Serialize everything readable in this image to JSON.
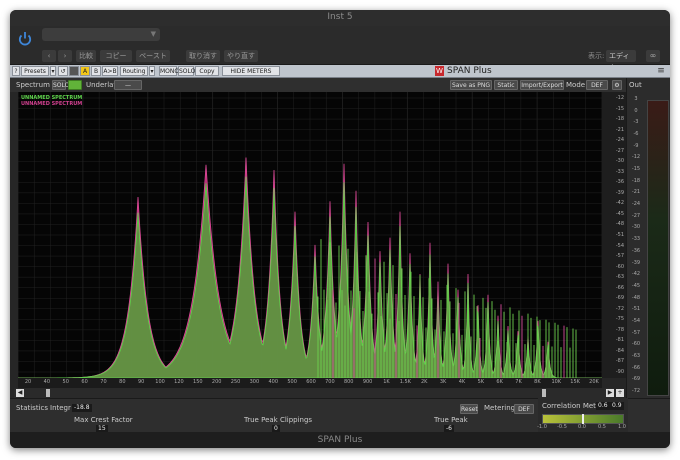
{
  "window": {
    "title": "Inst 5"
  },
  "host": {
    "preset_value": "",
    "buttons": {
      "compare": "比較",
      "copy": "コピー",
      "paste": "ペースト",
      "undo": "取り消す",
      "redo": "やり直す"
    },
    "view_label": "表示:",
    "view_value": "エディタ"
  },
  "plugin_bar": {
    "presets": "Presets",
    "a_label": "A",
    "b_label": "B",
    "ab_label": "A>B",
    "routing": "Routing",
    "mono": "MONO",
    "solo": "SOLO",
    "copy_to": "Copy to",
    "hide_meters": "HIDE METERS AND STATS",
    "brand": "SPAN Plus",
    "logo_letter": "W"
  },
  "spectrum_header": {
    "label": "Spectrum",
    "btn1": "SOLO",
    "btn2": "",
    "underlay_label": "Underlay",
    "underlay_value": "—",
    "save_png": "Save as PNG",
    "static": "Static",
    "import_export": "Import/Export",
    "mode_label": "Mode",
    "mode_value": "DEF"
  },
  "legend": [
    {
      "label": "UNNAMED SPECTRUM",
      "color": "#5fd44c"
    },
    {
      "label": "UNNAMED SPECTRUM",
      "color": "#d0408f"
    }
  ],
  "db_scale": [
    "-12",
    "-15",
    "-18",
    "-21",
    "-24",
    "-27",
    "-30",
    "-33",
    "-36",
    "-39",
    "-42",
    "-45",
    "-48",
    "-51",
    "-54",
    "-57",
    "-60",
    "-63",
    "-66",
    "-69",
    "-72",
    "-75",
    "-78",
    "-81",
    "-84",
    "-87",
    "-90"
  ],
  "freq_labels": [
    "20",
    "40",
    "50",
    "60",
    "70",
    "80",
    "90",
    "100",
    "120",
    "150",
    "200",
    "250",
    "300",
    "400",
    "500",
    "600",
    "700",
    "800",
    "900",
    "1K",
    "1.5K",
    "2K",
    "3K",
    "4K",
    "5K",
    "6K",
    "7K",
    "8K",
    "10K",
    "15K",
    "20K"
  ],
  "out_panel": {
    "label": "Out",
    "scale": [
      "3",
      "0",
      "-3",
      "-6",
      "-9",
      "-12",
      "-15",
      "-18",
      "-21",
      "-24",
      "-27",
      "-30",
      "-33",
      "-36",
      "-39",
      "-42",
      "-45",
      "-48",
      "-51",
      "-54",
      "-57",
      "-60",
      "-63",
      "-66",
      "-69",
      "-72"
    ]
  },
  "stats": {
    "label": "Statistics",
    "integr_label": "Integr",
    "integr_value": "-18.8",
    "reset": "Reset",
    "metering_label": "Metering",
    "metering_value": "DEF",
    "max_crest_label": "Max Crest Factor",
    "max_crest_value": "15",
    "tp_clip_label": "True Peak Clippings",
    "tp_clip_value": "0",
    "true_peak_label": "True Peak",
    "true_peak_value": "-6"
  },
  "correlation": {
    "label": "Correlation Meter",
    "v1": "0.6",
    "v2": "0.9",
    "scale": [
      "-1.0",
      "-0.5",
      "0.0",
      "0.5",
      "1.0"
    ]
  },
  "footer": {
    "title": "SPAN Plus"
  },
  "colors": {
    "green_spectrum": "#5fd44c",
    "pink_spectrum": "#c8307f",
    "grid": "#2a2a2a"
  }
}
